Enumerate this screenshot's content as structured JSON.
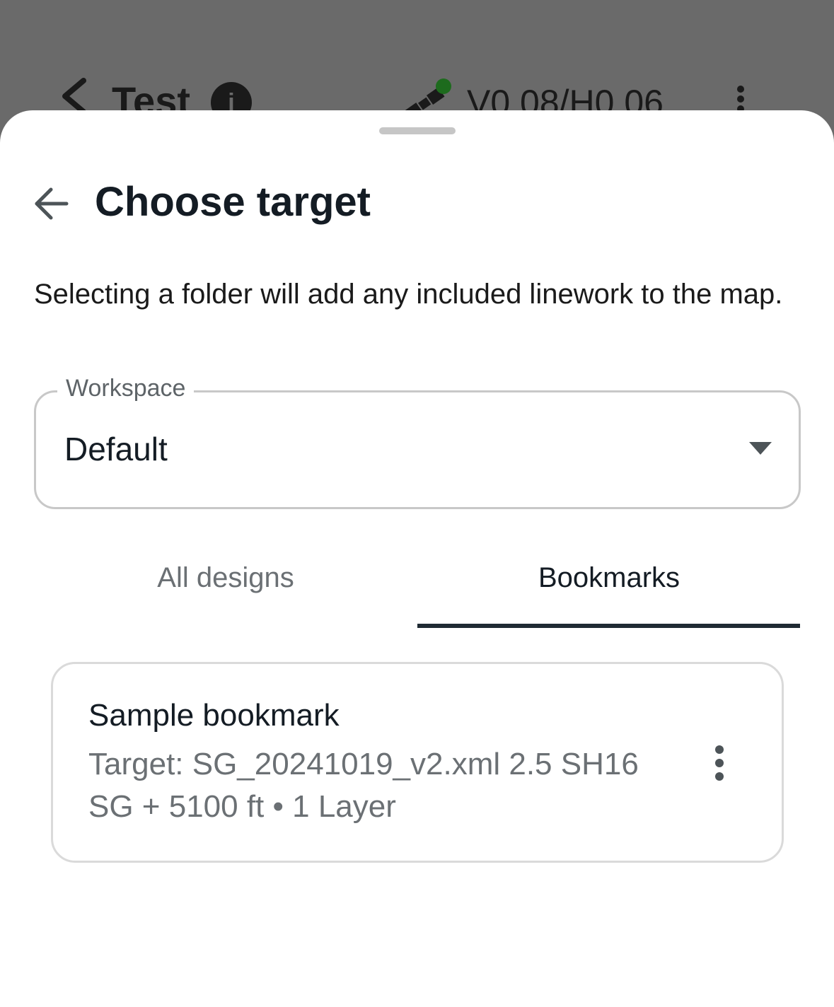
{
  "background": {
    "title": "Test",
    "info_icon": "info-icon",
    "accuracy": "V0.08/H0.06"
  },
  "sheet": {
    "title": "Choose target",
    "description": "Selecting a folder will add any included linework to the map.",
    "workspace": {
      "label": "Workspace",
      "value": "Default"
    },
    "tabs": [
      {
        "label": "All designs",
        "selected": false
      },
      {
        "label": "Bookmarks",
        "selected": true
      }
    ],
    "bookmarks": [
      {
        "title": "Sample bookmark",
        "subtitle": "Target: SG_20241019_v2.xml 2.5 SH16 SG + 5100 ft • 1 Layer"
      }
    ]
  },
  "colors": {
    "status_dot": "#1d6b1d",
    "tab_indicator": "#1f2a33"
  }
}
